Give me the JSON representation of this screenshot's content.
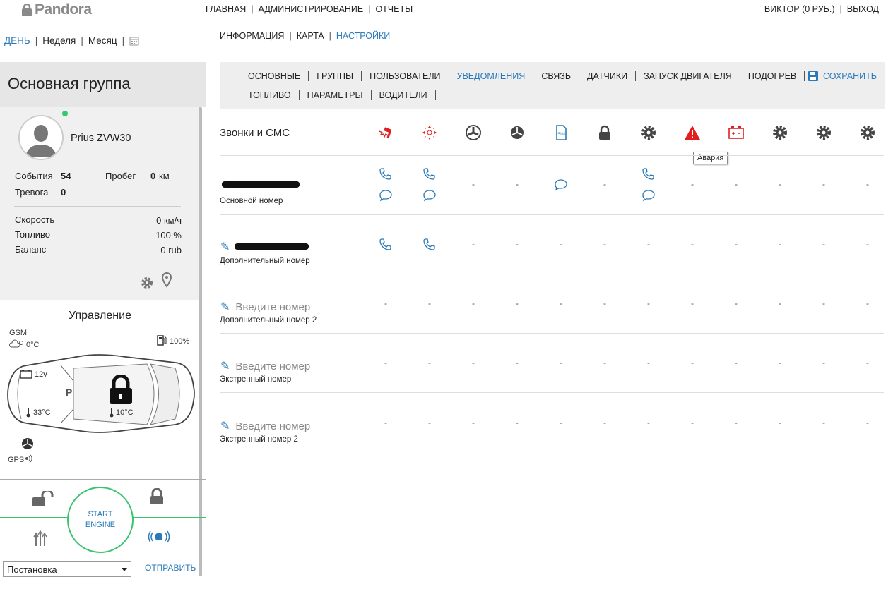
{
  "logo": "Pandora",
  "top_nav": [
    "ГЛАВНАЯ",
    "АДМИНИСТРИРОВАНИЕ",
    "ОТЧЕТЫ"
  ],
  "user": {
    "name": "ВИКТОР (0 РУБ.)",
    "logout": "ВЫХОД"
  },
  "period": {
    "day": "ДЕНЬ",
    "week": "Неделя",
    "month": "Месяц"
  },
  "sub_nav": [
    "ИНФОРМАЦИЯ",
    "КАРТА",
    "НАСТРОЙКИ"
  ],
  "group_title": "Основная группа",
  "vehicle": {
    "name": "Prius ZVW30",
    "events_label": "События",
    "events": "54",
    "mileage_label": "Пробег",
    "mileage": "0",
    "mileage_unit": "км",
    "alarm_label": "Тревога",
    "alarm": "0",
    "speed_label": "Скорость",
    "speed": "0 км/ч",
    "fuel_label": "Топливо",
    "fuel": "100 %",
    "balance_label": "Баланс",
    "balance": "0 rub"
  },
  "control": {
    "title": "Управление",
    "gsm": "GSM",
    "outside_temp": "0°C",
    "fuel_pct": "100%",
    "battery": "12v",
    "engine_temp": "33°C",
    "cabin_temp": "10°C",
    "gps": "GPS",
    "start_line1": "START",
    "start_line2": "ENGINE",
    "command_select": "Постановка",
    "send": "ОТПРАВИТЬ"
  },
  "tabs_row1": [
    "ОСНОВНЫЕ",
    "ГРУППЫ",
    "ПОЛЬЗОВАТЕЛИ",
    "УВЕДОМЛЕНИЯ",
    "СВЯЗЬ",
    "ДАТЧИКИ",
    "ЗАПУСК ДВИГАТЕЛЯ",
    "ПОДОГРЕВ"
  ],
  "tabs_row2": [
    "ТОПЛИВО",
    "ПАРАМЕТРЫ",
    "ВОДИТЕЛИ"
  ],
  "active_tab": "УВЕДОМЛЕНИЯ",
  "save": "СОХРАНИТЬ",
  "section_title": "Звонки и СМС",
  "column_icons": [
    "alarm-hammer-icon",
    "sensor-zones-icon",
    "fan-icon",
    "fan-icon",
    "sim-icon",
    "lock-icon",
    "gear-icon",
    "warning-triangle-icon",
    "battery-warning-icon",
    "gear-icon",
    "gear-icon",
    "gear-icon"
  ],
  "tooltip": "Авария",
  "rows": [
    {
      "label": "Основной номер",
      "placeholder": "",
      "masked": true,
      "cells": [
        "call+sms",
        "call+sms",
        "-",
        "-",
        "sms",
        "-",
        "call+sms",
        "-",
        "-",
        "-",
        "-",
        "-"
      ]
    },
    {
      "label": "Дополнительный номер",
      "placeholder": "",
      "masked": true,
      "cells": [
        "call",
        "call",
        "-",
        "-",
        "-",
        "-",
        "-",
        "-",
        "-",
        "-",
        "-",
        "-"
      ]
    },
    {
      "label": "Дополнительный номер 2",
      "placeholder": "Введите номер",
      "masked": false,
      "cells": [
        "-",
        "-",
        "-",
        "-",
        "-",
        "-",
        "-",
        "-",
        "-",
        "-",
        "-",
        "-"
      ]
    },
    {
      "label": "Экстренный номер",
      "placeholder": "Введите номер",
      "masked": false,
      "cells": [
        "-",
        "-",
        "-",
        "-",
        "-",
        "-",
        "-",
        "-",
        "-",
        "-",
        "-",
        "-"
      ]
    },
    {
      "label": "Экстренный номер 2",
      "placeholder": "Введите номер",
      "masked": false,
      "cells": [
        "-",
        "-",
        "-",
        "-",
        "-",
        "-",
        "-",
        "-",
        "-",
        "-",
        "-",
        "-"
      ]
    }
  ],
  "colors": {
    "accent": "#2a7ab9",
    "green": "#3bc46f",
    "red": "#e02020"
  }
}
